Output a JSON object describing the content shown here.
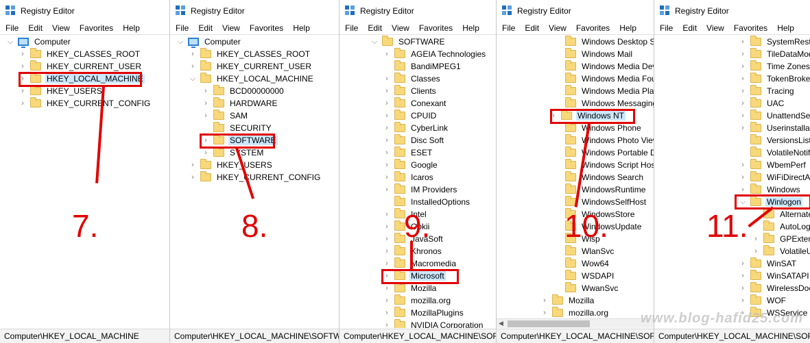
{
  "app_title": "Registry Editor",
  "menu": [
    "File",
    "Edit",
    "View",
    "Favorites",
    "Help"
  ],
  "panes": [
    {
      "step": "7.",
      "status": "Computer\\HKEY_LOCAL_MACHINE",
      "rows": [
        {
          "label": "Computer",
          "icon": "computer-icon",
          "expander": "expanded"
        },
        {
          "label": "HKEY_CLASSES_ROOT",
          "icon": "folder-icon",
          "expander": "collapsed"
        },
        {
          "label": "HKEY_CURRENT_USER",
          "icon": "folder-icon",
          "expander": "collapsed"
        },
        {
          "label": "HKEY_LOCAL_MACHINE",
          "icon": "folder-icon",
          "expander": "collapsed",
          "selected": true,
          "highlighted": true
        },
        {
          "label": "HKEY_USERS",
          "icon": "folder-icon",
          "expander": "collapsed"
        },
        {
          "label": "HKEY_CURRENT_CONFIG",
          "icon": "folder-icon",
          "expander": "collapsed"
        }
      ]
    },
    {
      "step": "8.",
      "status": "Computer\\HKEY_LOCAL_MACHINE\\SOFTWAR",
      "rows": [
        {
          "label": "Computer",
          "icon": "computer-icon",
          "expander": "expanded"
        },
        {
          "label": "HKEY_CLASSES_ROOT",
          "icon": "folder-icon",
          "expander": "collapsed"
        },
        {
          "label": "HKEY_CURRENT_USER",
          "icon": "folder-icon",
          "expander": "collapsed"
        },
        {
          "label": "HKEY_LOCAL_MACHINE",
          "icon": "folder-icon",
          "expander": "expanded"
        },
        {
          "label": "BCD00000000",
          "icon": "folder-icon",
          "expander": "collapsed"
        },
        {
          "label": "HARDWARE",
          "icon": "folder-icon",
          "expander": "collapsed"
        },
        {
          "label": "SAM",
          "icon": "folder-icon",
          "expander": "collapsed"
        },
        {
          "label": "SECURITY",
          "icon": "folder-icon",
          "expander": "none"
        },
        {
          "label": "SOFTWARE",
          "icon": "folder-icon",
          "expander": "collapsed",
          "selected": true,
          "highlighted": true
        },
        {
          "label": "SYSTEM",
          "icon": "folder-icon",
          "expander": "collapsed"
        },
        {
          "label": "HKEY_USERS",
          "icon": "folder-icon",
          "expander": "collapsed"
        },
        {
          "label": "HKEY_CURRENT_CONFIG",
          "icon": "folder-icon",
          "expander": "collapsed"
        }
      ]
    },
    {
      "step": "9.",
      "status": "Computer\\HKEY_LOCAL_MACHINE\\SOFTW",
      "rows": [
        {
          "label": "SOFTWARE",
          "icon": "folder-icon",
          "expander": "expanded"
        },
        {
          "label": "AGEIA Technologies",
          "icon": "folder-icon",
          "expander": "collapsed"
        },
        {
          "label": "BandiMPEG1",
          "icon": "folder-icon",
          "expander": "none"
        },
        {
          "label": "Classes",
          "icon": "folder-icon",
          "expander": "collapsed"
        },
        {
          "label": "Clients",
          "icon": "folder-icon",
          "expander": "collapsed"
        },
        {
          "label": "Conexant",
          "icon": "folder-icon",
          "expander": "collapsed"
        },
        {
          "label": "CPUID",
          "icon": "folder-icon",
          "expander": "collapsed"
        },
        {
          "label": "CyberLink",
          "icon": "folder-icon",
          "expander": "collapsed"
        },
        {
          "label": "Disc Soft",
          "icon": "folder-icon",
          "expander": "collapsed"
        },
        {
          "label": "ESET",
          "icon": "folder-icon",
          "expander": "collapsed"
        },
        {
          "label": "Google",
          "icon": "folder-icon",
          "expander": "collapsed"
        },
        {
          "label": "Icaros",
          "icon": "folder-icon",
          "expander": "collapsed"
        },
        {
          "label": "IM Providers",
          "icon": "folder-icon",
          "expander": "collapsed"
        },
        {
          "label": "InstalledOptions",
          "icon": "folder-icon",
          "expander": "none"
        },
        {
          "label": "Intel",
          "icon": "folder-icon",
          "expander": "collapsed"
        },
        {
          "label": "Ookii",
          "icon": "folder-icon",
          "expander": "collapsed"
        },
        {
          "label": "JavaSoft",
          "icon": "folder-icon",
          "expander": "collapsed"
        },
        {
          "label": "Khronos",
          "icon": "folder-icon",
          "expander": "collapsed"
        },
        {
          "label": "Macromedia",
          "icon": "folder-icon",
          "expander": "collapsed"
        },
        {
          "label": "Microsoft",
          "icon": "folder-icon",
          "expander": "collapsed",
          "selected": true,
          "highlighted": true
        },
        {
          "label": "Mozilla",
          "icon": "folder-icon",
          "expander": "collapsed"
        },
        {
          "label": "mozilla.org",
          "icon": "folder-icon",
          "expander": "collapsed"
        },
        {
          "label": "MozillaPlugins",
          "icon": "folder-icon",
          "expander": "collapsed"
        },
        {
          "label": "NVIDIA Corporation",
          "icon": "folder-icon",
          "expander": "collapsed"
        }
      ]
    },
    {
      "step": "10.",
      "status": "Computer\\HKEY_LOCAL_MACHINE\\SOFTV",
      "rows": [
        {
          "label": "Windows Desktop Se",
          "icon": "folder-icon",
          "expander": "none"
        },
        {
          "label": "Windows Mail",
          "icon": "folder-icon",
          "expander": "none"
        },
        {
          "label": "Windows Media Dev",
          "icon": "folder-icon",
          "expander": "none"
        },
        {
          "label": "Windows Media Fou",
          "icon": "folder-icon",
          "expander": "none"
        },
        {
          "label": "Windows Media Play",
          "icon": "folder-icon",
          "expander": "none"
        },
        {
          "label": "Windows Messaging",
          "icon": "folder-icon",
          "expander": "none"
        },
        {
          "label": "Windows NT",
          "icon": "folder-icon",
          "expander": "collapsed",
          "selected": true,
          "highlighted": true
        },
        {
          "label": "Windows Phone",
          "icon": "folder-icon",
          "expander": "none"
        },
        {
          "label": "Windows Photo View",
          "icon": "folder-icon",
          "expander": "none"
        },
        {
          "label": "Windows Portable D",
          "icon": "folder-icon",
          "expander": "none"
        },
        {
          "label": "Windows Script Host",
          "icon": "folder-icon",
          "expander": "none"
        },
        {
          "label": "Windows Search",
          "icon": "folder-icon",
          "expander": "none"
        },
        {
          "label": "WindowsRuntime",
          "icon": "folder-icon",
          "expander": "none"
        },
        {
          "label": "WindowsSelfHost",
          "icon": "folder-icon",
          "expander": "none"
        },
        {
          "label": "WindowsStore",
          "icon": "folder-icon",
          "expander": "none"
        },
        {
          "label": "WindowsUpdate",
          "icon": "folder-icon",
          "expander": "none"
        },
        {
          "label": "Wisp",
          "icon": "folder-icon",
          "expander": "none"
        },
        {
          "label": "WlanSvc",
          "icon": "folder-icon",
          "expander": "none"
        },
        {
          "label": "Wow64",
          "icon": "folder-icon",
          "expander": "none"
        },
        {
          "label": "WSDAPI",
          "icon": "folder-icon",
          "expander": "none"
        },
        {
          "label": "WwanSvc",
          "icon": "folder-icon",
          "expander": "none"
        },
        {
          "label": "Mozilla",
          "icon": "folder-icon",
          "expander": "collapsed"
        },
        {
          "label": "mozilla.org",
          "icon": "folder-icon",
          "expander": "collapsed"
        }
      ]
    },
    {
      "step": "11.",
      "status": "Computer\\HKEY_LOCAL_MACHINE\\SOFTWARE\\Microso",
      "rows": [
        {
          "label": "SystemRestore",
          "icon": "folder-icon",
          "expander": "collapsed"
        },
        {
          "label": "TileDataModel",
          "icon": "folder-icon",
          "expander": "collapsed"
        },
        {
          "label": "Time Zones",
          "icon": "folder-icon",
          "expander": "collapsed"
        },
        {
          "label": "TokenBroker",
          "icon": "folder-icon",
          "expander": "collapsed"
        },
        {
          "label": "Tracing",
          "icon": "folder-icon",
          "expander": "collapsed"
        },
        {
          "label": "UAC",
          "icon": "folder-icon",
          "expander": "collapsed"
        },
        {
          "label": "UnattendSettings",
          "icon": "folder-icon",
          "expander": "collapsed"
        },
        {
          "label": "Userinstallable",
          "icon": "folder-icon",
          "expander": "collapsed"
        },
        {
          "label": "VersionsList",
          "icon": "folder-icon",
          "expander": "none"
        },
        {
          "label": "VolatileNotifications",
          "icon": "folder-icon",
          "expander": "none"
        },
        {
          "label": "WbemPerf",
          "icon": "folder-icon",
          "expander": "collapsed"
        },
        {
          "label": "WiFiDirectAPI",
          "icon": "folder-icon",
          "expander": "collapsed"
        },
        {
          "label": "Windows",
          "icon": "folder-icon",
          "expander": "collapsed"
        },
        {
          "label": "Winlogon",
          "icon": "folder-icon",
          "expander": "expanded",
          "selected": true,
          "highlighted": true
        },
        {
          "label": "AlternateShells",
          "icon": "folder-icon",
          "expander": "none"
        },
        {
          "label": "AutoLogonChecked",
          "icon": "folder-icon",
          "expander": "none"
        },
        {
          "label": "GPExtensions",
          "icon": "folder-icon",
          "expander": "collapsed"
        },
        {
          "label": "VolatileUserMgrKey",
          "icon": "folder-icon",
          "expander": "collapsed"
        },
        {
          "label": "WinSAT",
          "icon": "folder-icon",
          "expander": "collapsed"
        },
        {
          "label": "WinSATAPI",
          "icon": "folder-icon",
          "expander": "collapsed"
        },
        {
          "label": "WirelessDocking",
          "icon": "folder-icon",
          "expander": "collapsed"
        },
        {
          "label": "WOF",
          "icon": "folder-icon",
          "expander": "collapsed"
        },
        {
          "label": "WSService",
          "icon": "folder-icon",
          "expander": "collapsed"
        }
      ]
    }
  ],
  "watermark": "www.blog-hafid25.com",
  "colors": {
    "annotation_red": "#e00000",
    "selection_bg": "#cce8ff",
    "folder": "#f7d87a"
  }
}
